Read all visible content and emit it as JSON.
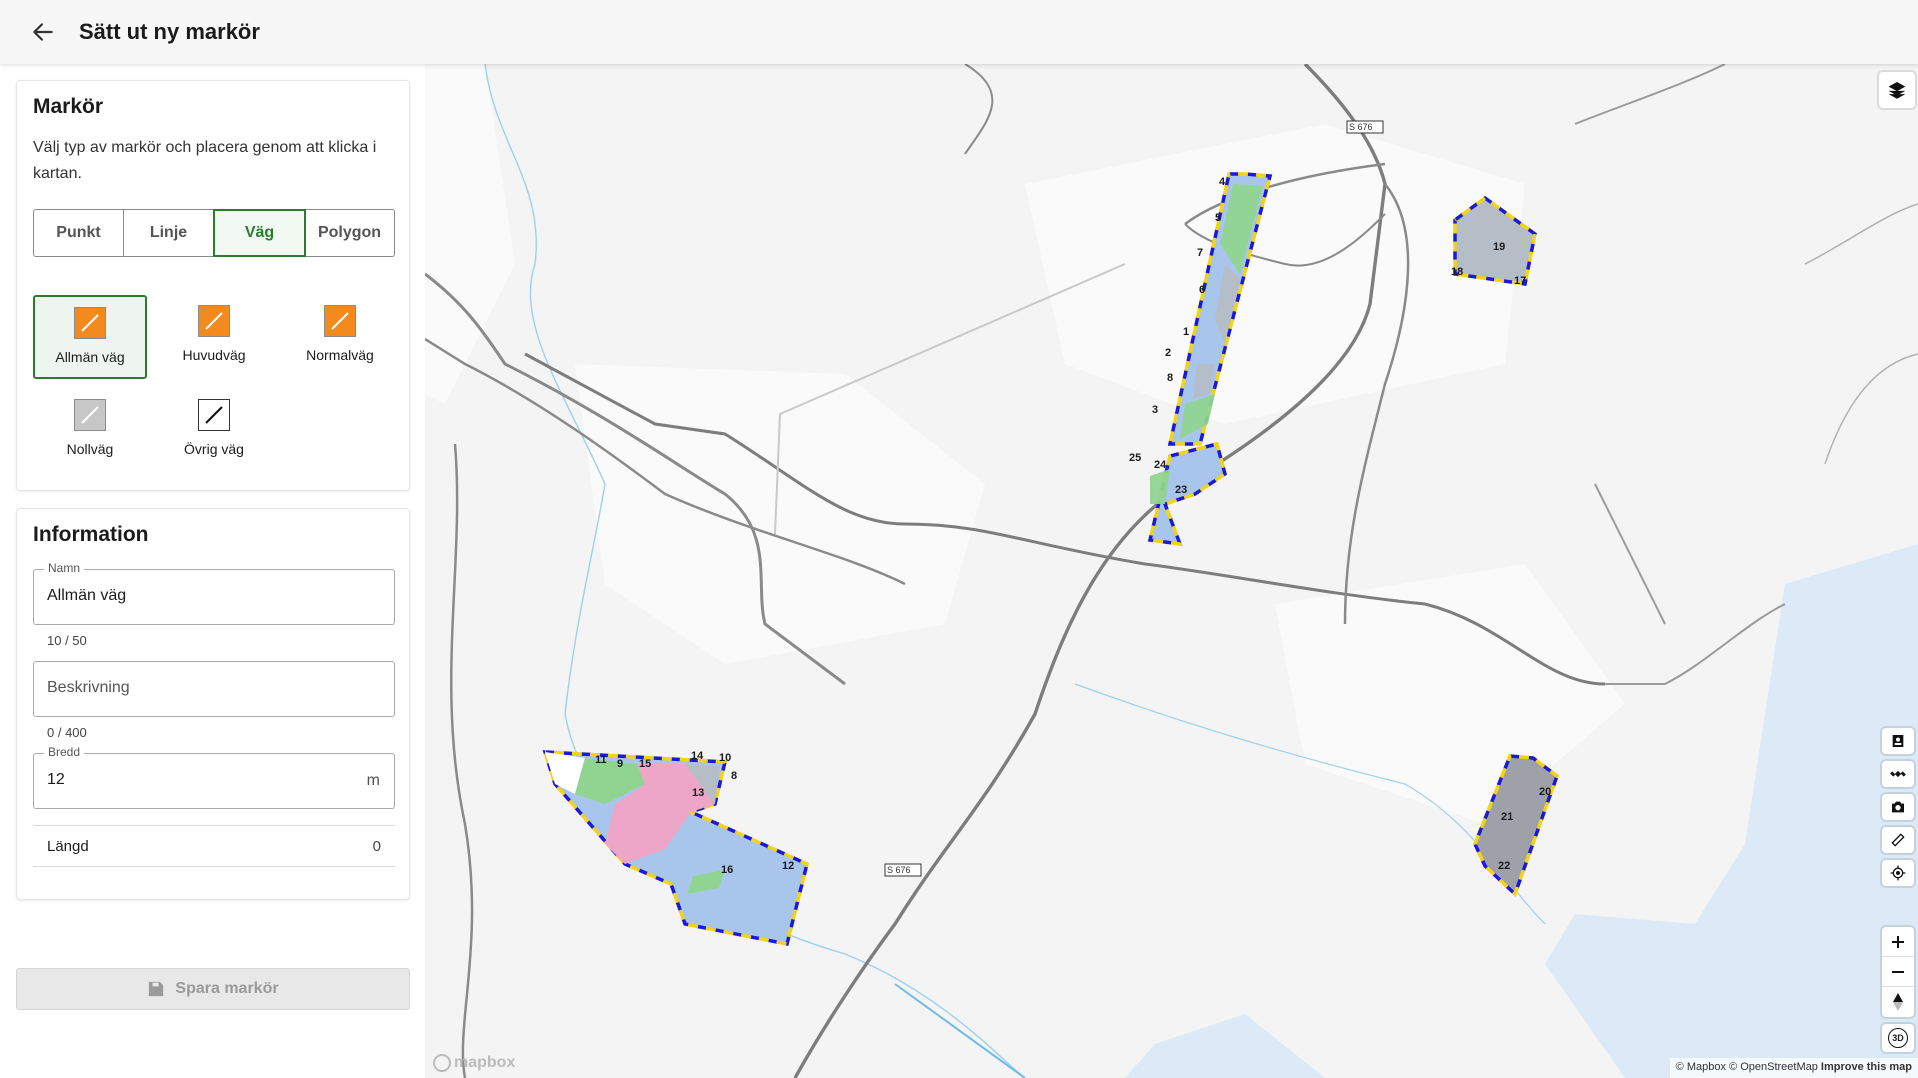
{
  "header": {
    "title": "Sätt ut ny markör",
    "back_icon": "arrow-left-icon"
  },
  "marker_card": {
    "title": "Markör",
    "description": "Välj typ av markör och placera genom att klicka i kartan.",
    "segments": [
      {
        "label": "Punkt",
        "active": false
      },
      {
        "label": "Linje",
        "active": false
      },
      {
        "label": "Väg",
        "active": true
      },
      {
        "label": "Polygon",
        "active": false
      }
    ],
    "road_types": [
      {
        "label": "Allmän väg",
        "color": "#f28a1e",
        "selected": true
      },
      {
        "label": "Huvudväg",
        "color": "#f28a1e",
        "selected": false
      },
      {
        "label": "Normalväg",
        "color": "#f28a1e",
        "selected": false
      },
      {
        "label": "Nollväg",
        "color": "#c7c7c7",
        "selected": false
      },
      {
        "label": "Övrig väg",
        "color": "#ffffff",
        "selected": false
      }
    ]
  },
  "info_card": {
    "title": "Information",
    "name_label": "Namn",
    "name_value": "Allmän väg",
    "name_counter": "10 / 50",
    "description_placeholder": "Beskrivning",
    "description_counter": "0 / 400",
    "width_label": "Bredd",
    "width_value": "12",
    "width_unit": "m",
    "length_label": "Längd",
    "length_value": "0"
  },
  "save_button": {
    "label": "Spara markör",
    "icon": "save-icon",
    "disabled": true
  },
  "map": {
    "road_labels": [
      "S 676",
      "S 676"
    ],
    "parcel_labels": [
      "4",
      "5",
      "7",
      "6",
      "1",
      "2",
      "8",
      "3",
      "25",
      "24",
      "23",
      "19",
      "18",
      "17",
      "11",
      "9",
      "15",
      "14",
      "10",
      "8",
      "13",
      "16",
      "12",
      "21",
      "20",
      "22"
    ],
    "controls": [
      "layers-icon",
      "contact-icon",
      "satellite-icon",
      "camera-icon",
      "ruler-icon",
      "locate-icon",
      "zoom-in-icon",
      "zoom-out-icon",
      "compass-icon",
      "3d-icon"
    ],
    "three_d_label": "3D",
    "attribution": {
      "mapbox": "© Mapbox",
      "osm": "© OpenStreetMap",
      "improve": "Improve this map"
    },
    "logo_text": "mapbox"
  }
}
